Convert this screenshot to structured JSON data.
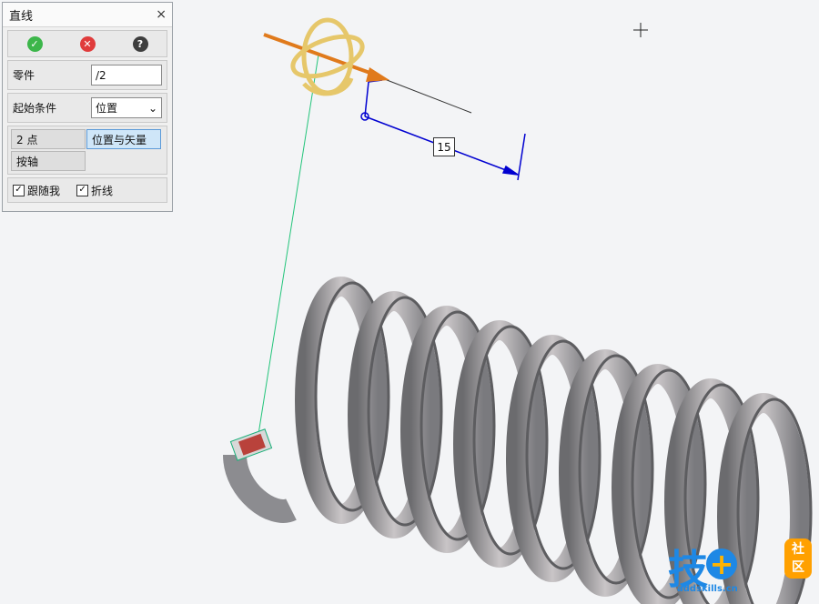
{
  "panel": {
    "title": "直线",
    "close_glyph": "×",
    "actions": {
      "ok_icon": "check-circle-icon",
      "cancel_icon": "x-circle-icon",
      "help_icon": "question-circle-icon",
      "ok_glyph": "✓",
      "cancel_glyph": "✕",
      "help_glyph": "?"
    },
    "part": {
      "label": "零件",
      "value": "/2"
    },
    "start": {
      "label": "起始条件",
      "value": "位置",
      "chevron": "⌄"
    },
    "modes": {
      "two_point": "2 点",
      "pos_vector": "位置与矢量",
      "by_axis": "按轴"
    },
    "follow_me": {
      "label": "跟随我",
      "checked": true,
      "mark": "✓"
    },
    "polyline": {
      "label": "折线",
      "checked": true,
      "mark": "✓"
    }
  },
  "viewport": {
    "dimension_value": "15",
    "colors": {
      "spring": "#8f8f92",
      "dimension": "#0000d0",
      "green_line": "#22c47a",
      "handle": "#e6c76a",
      "arrow": "#e07a1c"
    }
  },
  "watermark": {
    "logo_text": "技",
    "plus": "+",
    "she": "社",
    "qu": "区",
    "url": "addskills.cn"
  }
}
